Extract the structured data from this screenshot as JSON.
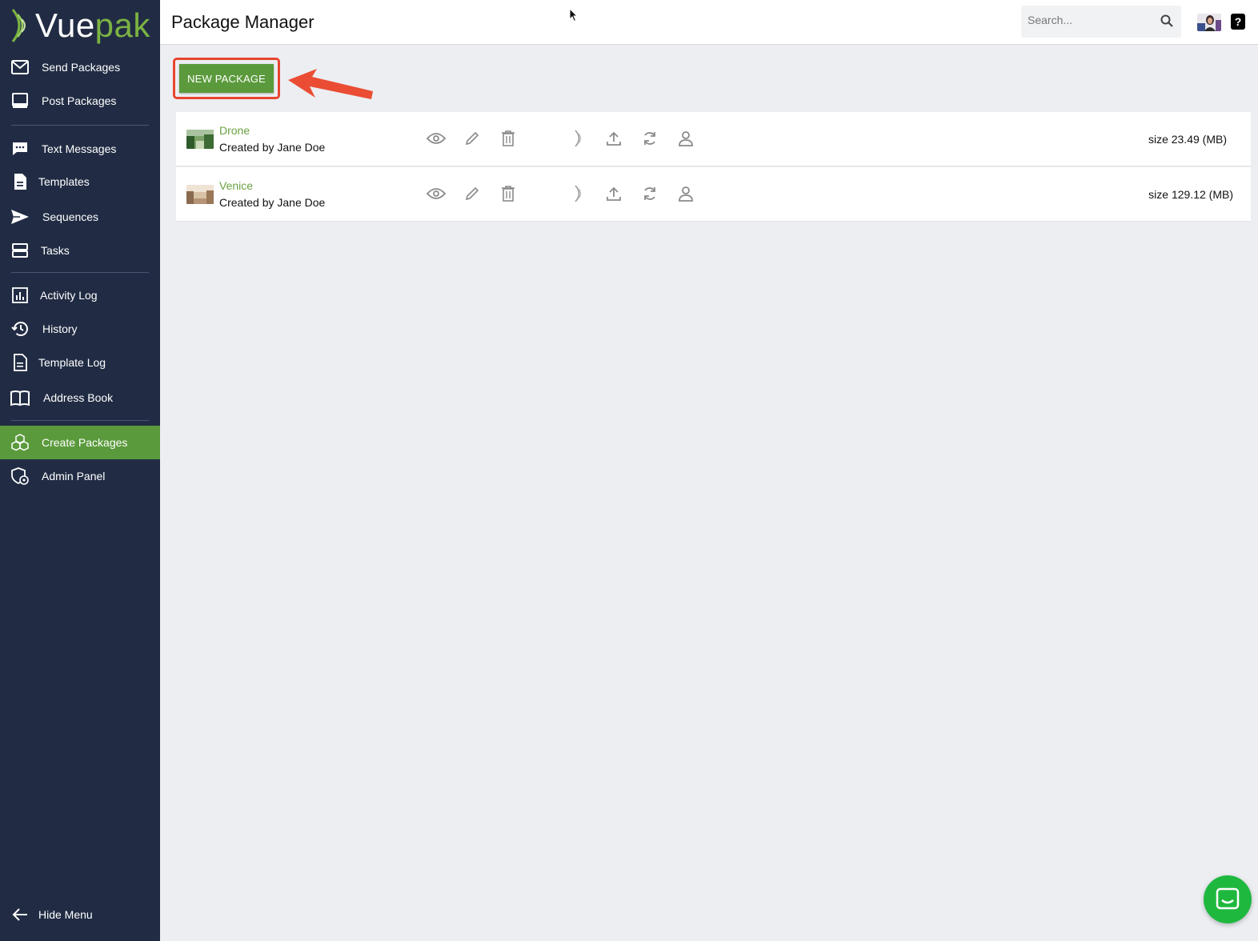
{
  "brand": {
    "part1": "Vue",
    "part2": "pak"
  },
  "sidebar": {
    "items": [
      {
        "label": "Send Packages",
        "icon": "envelope-icon"
      },
      {
        "label": "Post Packages",
        "icon": "monitor-icon"
      },
      {
        "label": "Text Messages",
        "icon": "chat-bubble-icon"
      },
      {
        "label": "Templates",
        "icon": "document-icon"
      },
      {
        "label": "Sequences",
        "icon": "send-icon"
      },
      {
        "label": "Tasks",
        "icon": "list-icon"
      },
      {
        "label": "Activity Log",
        "icon": "bar-chart-icon"
      },
      {
        "label": "History",
        "icon": "history-icon"
      },
      {
        "label": "Template Log",
        "icon": "document-icon"
      },
      {
        "label": "Address Book",
        "icon": "book-icon"
      },
      {
        "label": "Create Packages",
        "icon": "boxes-icon",
        "active": true
      },
      {
        "label": "Admin Panel",
        "icon": "admin-shield-icon"
      }
    ],
    "hide_menu": "Hide Menu"
  },
  "header": {
    "title": "Package Manager",
    "search_placeholder": "Search...",
    "help": "?"
  },
  "main": {
    "new_package_label": "New Package",
    "packages": [
      {
        "name": "Drone",
        "creator": "Created by Jane Doe",
        "size": "size 23.49 (MB)"
      },
      {
        "name": "Venice",
        "creator": "Created by Jane Doe",
        "size": "size 129.12 (MB)"
      }
    ]
  },
  "colors": {
    "sidebar_bg": "#212c44",
    "accent_green": "#5b9a3c",
    "link_green": "#6aa240",
    "annotation_red": "#e8452f",
    "chat_green": "#1fb83f"
  }
}
